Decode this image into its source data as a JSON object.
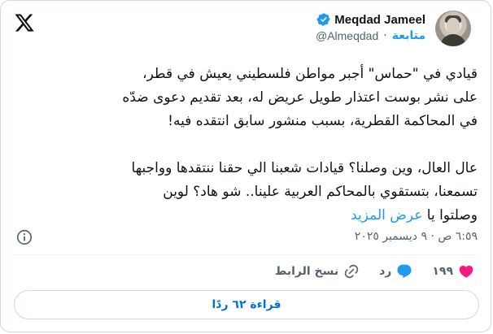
{
  "author": {
    "name": "Meqdad Jameel",
    "handle": "@Almeqdad",
    "follow_label": "متابعة",
    "separator": "·"
  },
  "tweet": {
    "paragraph1_line1": "قيادي في \"حماس\" أجبر مواطن فلسطيني يعيش في قطر،",
    "paragraph1_line2": "على نشر بوست اعتذار طويل عريض له، بعد تقديم دعوى ضدّه",
    "paragraph1_line3": "في المحاكمة القطرية، بسبب منشور سابق انتقده فيه!",
    "paragraph2_line1": "عال العال، وين وصلنا؟ قيادات شعبنا الي حقنا ننتقدها وواجبها",
    "paragraph2_line2": "تسمعنا، بتستقوي بالمحاكم العربية علينا.. شو هاد؟ لوين",
    "paragraph2_line3": "وصلتوا يا",
    "show_more": "عرض المزيد"
  },
  "meta": {
    "timestamp": "٦:٥٩ ص · ٩ ديسمبر ٢٠٢٥"
  },
  "actions": {
    "likes": "١٩٩",
    "reply_label": "رد",
    "copy_link_label": "نسخ الرابط"
  },
  "replies_button": "قراءة ٦٢ ردًا",
  "colors": {
    "accent": "#1d9bf0",
    "like": "#f91880",
    "text": "#0f1419",
    "muted": "#536471"
  },
  "icons": [
    "x-logo-icon",
    "verified-badge-icon",
    "info-icon",
    "heart-icon",
    "reply-bubble-icon",
    "link-icon"
  ]
}
